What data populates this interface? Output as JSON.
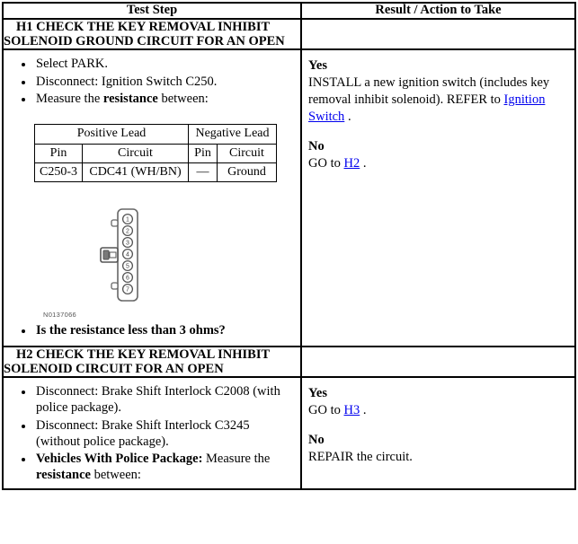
{
  "table": {
    "columns": [
      {
        "label": "Test Step"
      },
      {
        "label": "Result / Action to Take"
      }
    ]
  },
  "sections": [
    {
      "id": "H1",
      "title": "H1 CHECK THE KEY REMOVAL INHIBIT SOLENOID GROUND CIRCUIT FOR AN OPEN",
      "steps": [
        {
          "text": "Select PARK."
        },
        {
          "text": "Disconnect: Ignition Switch C250."
        },
        {
          "pre": "Measure the ",
          "bold": "resistance",
          "post": " between:"
        }
      ],
      "lead_table": {
        "group_headers": [
          "Positive Lead",
          "Negative Lead"
        ],
        "sub_headers": [
          "Pin",
          "Circuit",
          "Pin",
          "Circuit"
        ],
        "rows": [
          [
            "C250-3",
            "CDC41 (WH/BN)",
            "—",
            "Ground"
          ]
        ]
      },
      "figure": {
        "id_label": "N0137066",
        "icon": "connector-7-pin",
        "pins": [
          "1",
          "2",
          "3",
          "4",
          "5",
          "6",
          "7"
        ]
      },
      "question": "Is the resistance less than 3 ohms?",
      "result": {
        "yes_label": "Yes",
        "yes_pre": "INSTALL a new ignition switch (includes key removal inhibit solenoid). REFER to ",
        "yes_link": "Ignition Switch",
        "yes_post": " .",
        "no_label": "No",
        "no_pre": "GO to ",
        "no_link": "H2",
        "no_post": " ."
      }
    },
    {
      "id": "H2",
      "title": "H2 CHECK THE KEY REMOVAL INHIBIT SOLENOID CIRCUIT FOR AN OPEN",
      "steps": [
        {
          "text": "Disconnect: Brake Shift Interlock C2008 (with police package)."
        },
        {
          "text": "Disconnect: Brake Shift Interlock C3245 (without police package)."
        },
        {
          "pre": "",
          "bold": "Vehicles With Police Package:",
          "mid": " Measure the ",
          "bold2": "resistance",
          "post": " between:"
        }
      ],
      "result": {
        "yes_label": "Yes",
        "yes_pre": "GO to ",
        "yes_link": "H3",
        "yes_post": " .",
        "no_label": "No",
        "no_text": "REPAIR the circuit."
      }
    }
  ],
  "colors": {
    "link": "#0000ee",
    "border": "#000000",
    "figure_line": "#555555"
  }
}
